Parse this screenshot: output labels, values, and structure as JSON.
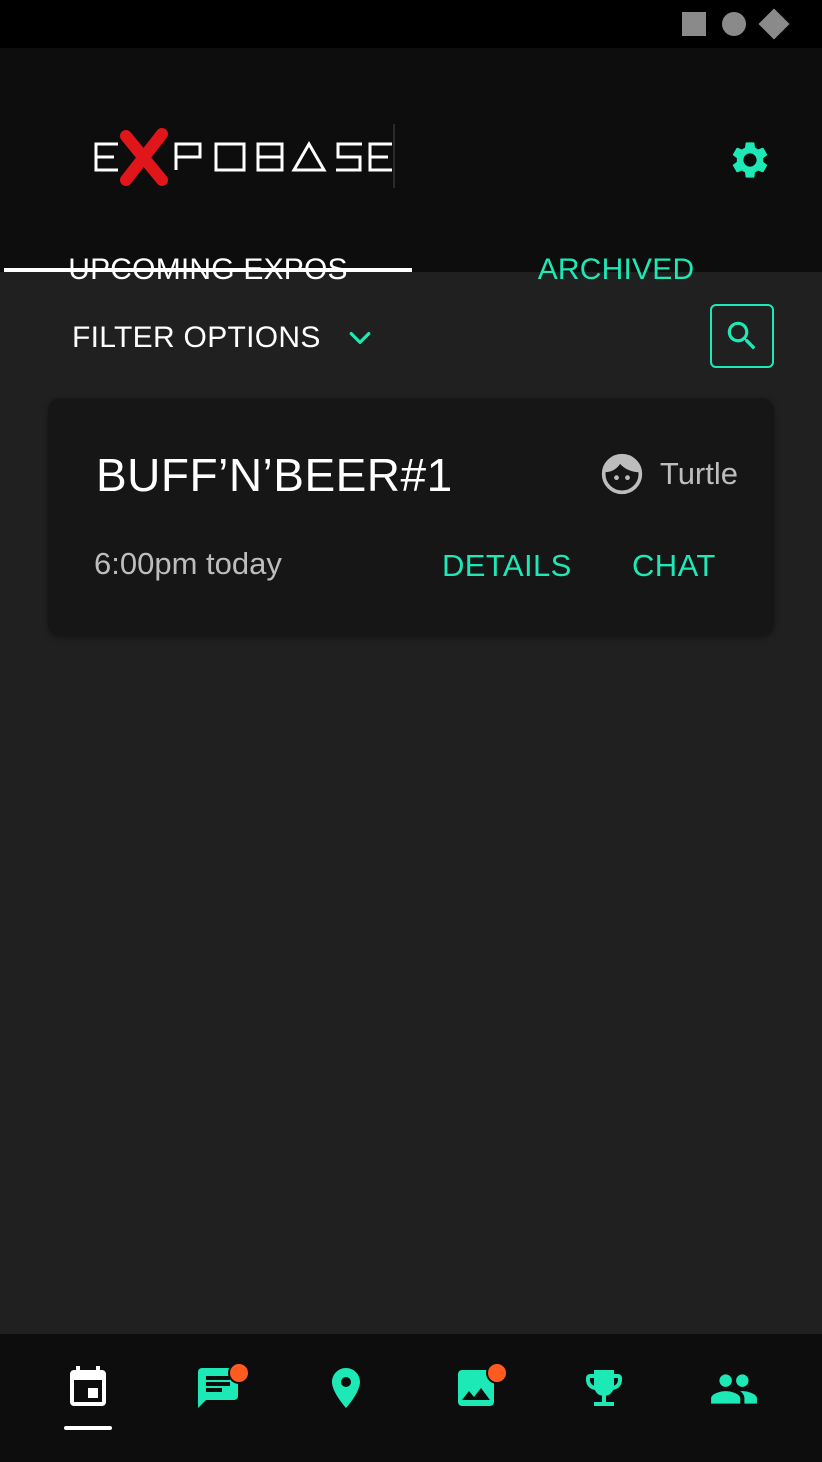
{
  "colors": {
    "accent": "#1de9b6",
    "badge": "#ff5a1f",
    "logo_red": "#e0161b",
    "header_bg": "#0d0d0d",
    "content_bg": "#202020",
    "card_bg": "#161616"
  },
  "status_bar": {
    "icons": [
      "square-icon",
      "circle-icon",
      "diamond-icon"
    ]
  },
  "header": {
    "logo_text": "EXPOBASE",
    "settings_icon": "gear-icon"
  },
  "tabs": [
    {
      "label": "UPCOMING EXPOS",
      "active": true
    },
    {
      "label": "ARCHIVED",
      "active": false
    }
  ],
  "filter": {
    "label": "FILTER OPTIONS",
    "chevron_icon": "chevron-down-icon",
    "search_icon": "search-icon"
  },
  "expos": [
    {
      "title": "BUFF’N’BEER#1",
      "host_name": "Turtle",
      "host_icon": "face-icon",
      "time": "6:00pm today",
      "details_label": "DETAILS",
      "chat_label": "CHAT"
    }
  ],
  "bottom_nav": [
    {
      "icon": "calendar-icon",
      "active": true,
      "badge": false
    },
    {
      "icon": "message-icon",
      "active": false,
      "badge": true
    },
    {
      "icon": "location-pin-icon",
      "active": false,
      "badge": false
    },
    {
      "icon": "image-icon",
      "active": false,
      "badge": true
    },
    {
      "icon": "trophy-icon",
      "active": false,
      "badge": false
    },
    {
      "icon": "people-icon",
      "active": false,
      "badge": false
    }
  ]
}
